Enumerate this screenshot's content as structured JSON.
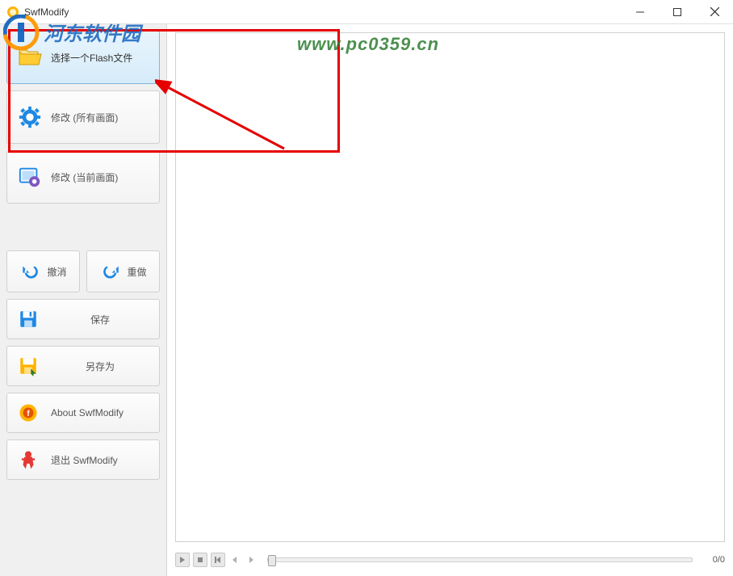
{
  "window": {
    "title": "SwfModify"
  },
  "sidebar": {
    "select_flash": "选择一个Flash文件",
    "modify_all": "修改 (所有画面)",
    "modify_current": "修改 (当前画面)",
    "undo": "撤消",
    "redo": "重做",
    "save": "保存",
    "save_as": "另存为",
    "about": "About SwfModify",
    "exit": "退出 SwfModify"
  },
  "playbar": {
    "counter": "0/0"
  },
  "watermark": {
    "site_name": "河东软件园",
    "site_url": "www.pc0359.cn"
  }
}
